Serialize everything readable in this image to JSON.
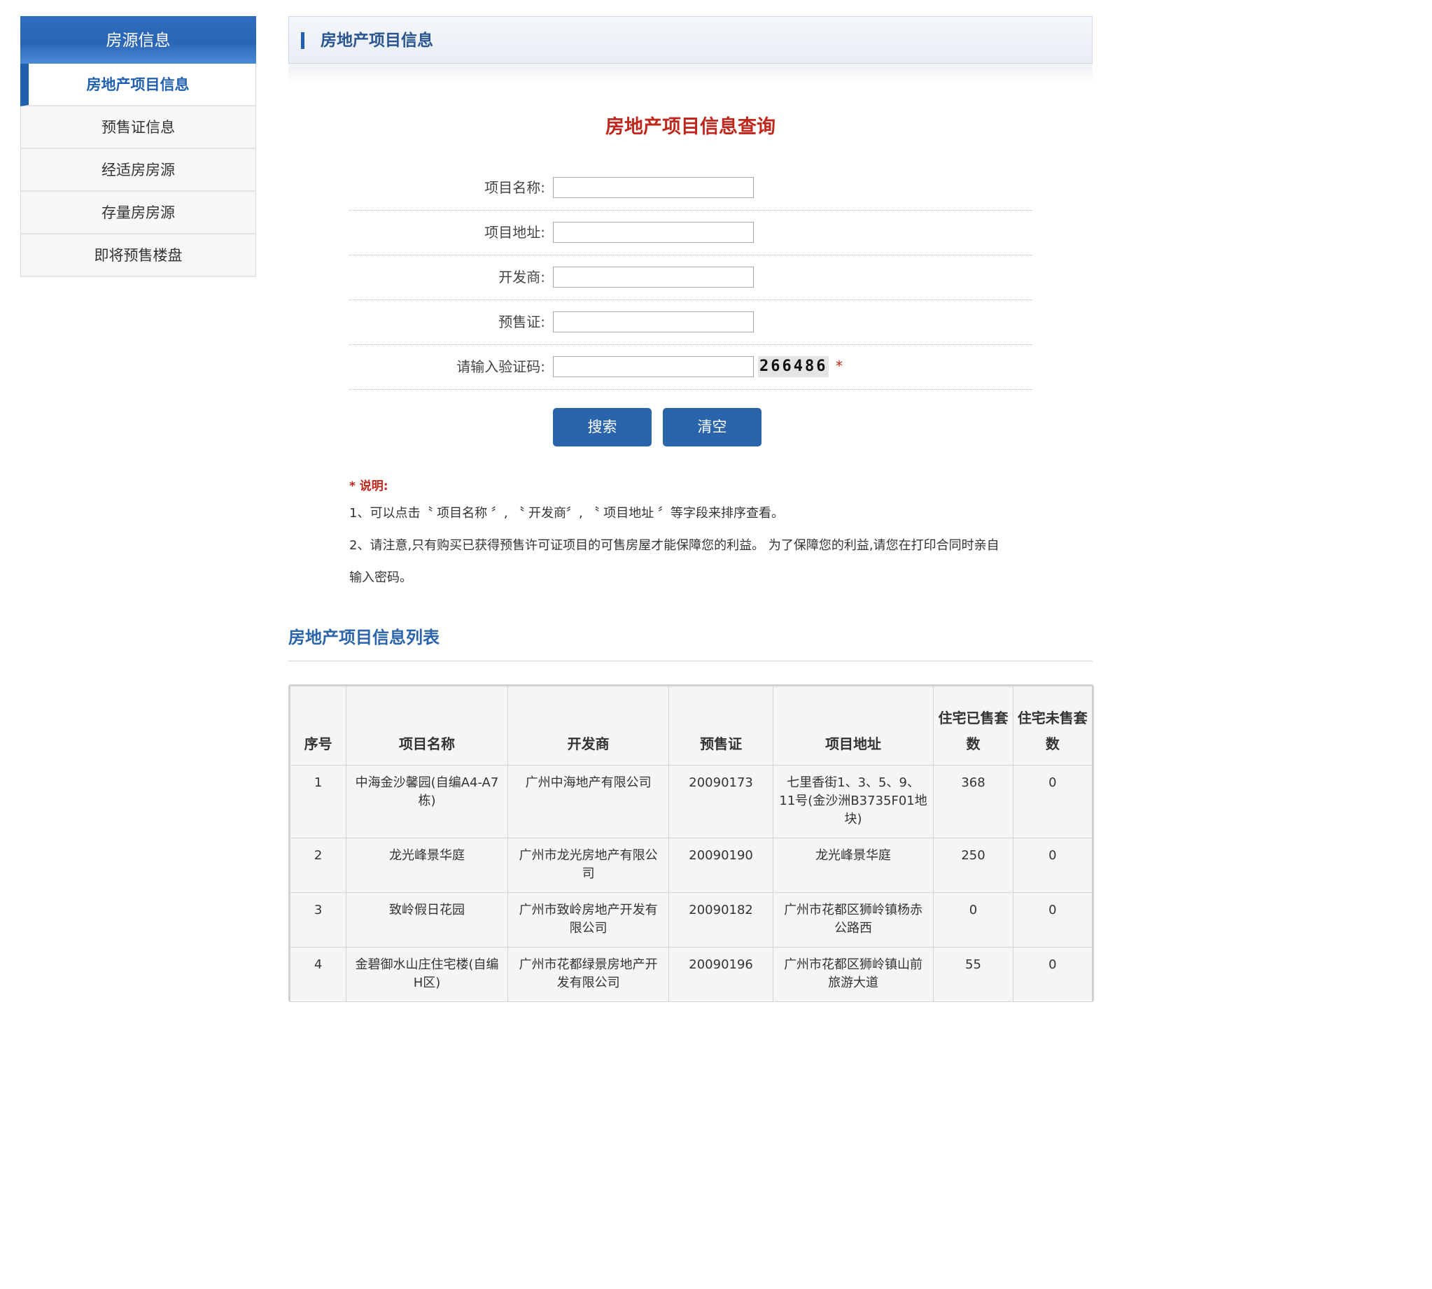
{
  "sidebar": {
    "header": "房源信息",
    "items": [
      {
        "label": "房地产项目信息"
      },
      {
        "label": "预售证信息"
      },
      {
        "label": "经适房房源"
      },
      {
        "label": "存量房房源"
      },
      {
        "label": "即将预售楼盘"
      }
    ]
  },
  "main": {
    "header_title": "房地产项目信息",
    "query_title": "房地产项目信息查询",
    "form": {
      "project_name_label": "项目名称:",
      "project_address_label": "项目地址:",
      "developer_label": "开发商:",
      "presale_label": "预售证:",
      "captcha_label": "请输入验证码:",
      "captcha_value": "266486",
      "required_mark": "*"
    },
    "buttons": {
      "search": "搜索",
      "clear": "清空"
    },
    "notes": {
      "title": "* 说明:",
      "line1": "1、可以点击〝 项目名称 〞, 〝 开发商〞, 〝 项目地址 〞等字段来排序查看。",
      "line2": "2、请注意,只有购买已获得预售许可证项目的可售房屋才能保障您的利益。 为了保障您的利益,请您在打印合同时亲自",
      "line3": "输入密码。"
    },
    "list_title": "房地产项目信息列表",
    "table": {
      "headers": [
        "序号",
        "项目名称",
        "开发商",
        "预售证",
        "项目地址",
        "住宅已售套数",
        "住宅未售套数"
      ],
      "rows": [
        {
          "no": "1",
          "name": "中海金沙馨园(自编A4-A7栋)",
          "developer": "广州中海地产有限公司",
          "presale": "20090173",
          "address": "七里香街1、3、5、9、11号(金沙洲B3735F01地块)",
          "sold": "368",
          "unsold": "0"
        },
        {
          "no": "2",
          "name": "龙光峰景华庭",
          "developer": "广州市龙光房地产有限公司",
          "presale": "20090190",
          "address": "龙光峰景华庭",
          "sold": "250",
          "unsold": "0"
        },
        {
          "no": "3",
          "name": "致岭假日花园",
          "developer": "广州市致岭房地产开发有限公司",
          "presale": "20090182",
          "address": "广州市花都区狮岭镇杨赤公路西",
          "sold": "0",
          "unsold": "0"
        },
        {
          "no": "4",
          "name": "金碧御水山庄住宅楼(自编H区)",
          "developer": "广州市花都绿景房地产开发有限公司",
          "presale": "20090196",
          "address": "广州市花都区狮岭镇山前旅游大道",
          "sold": "55",
          "unsold": "0"
        }
      ]
    }
  }
}
